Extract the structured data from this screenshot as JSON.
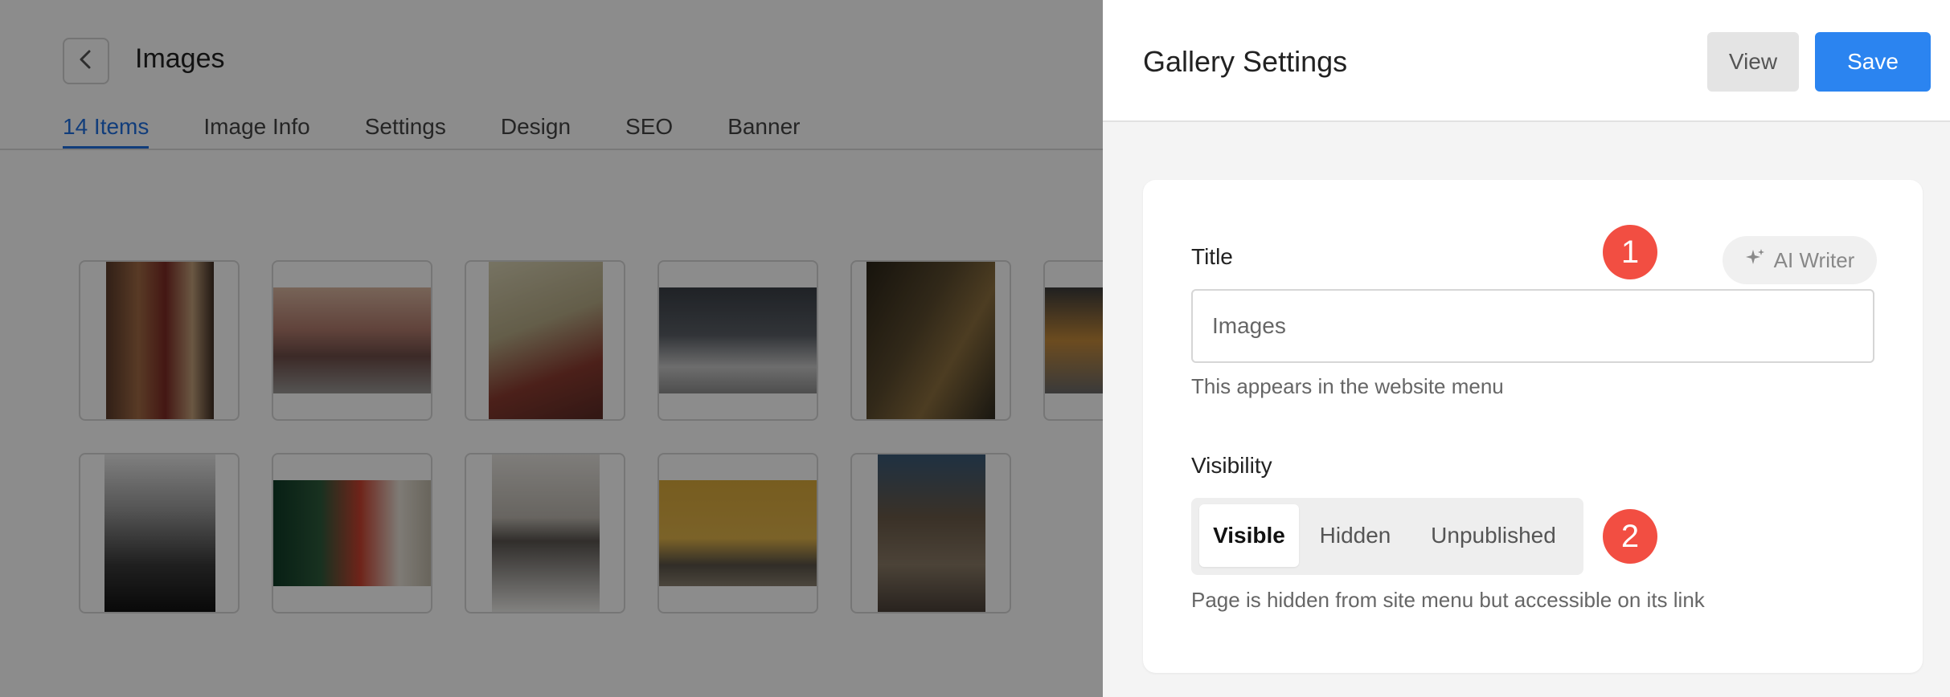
{
  "page": {
    "title": "Images",
    "tabs": [
      {
        "label": "14 Items",
        "active": true
      },
      {
        "label": "Image Info",
        "active": false
      },
      {
        "label": "Settings",
        "active": false
      },
      {
        "label": "Design",
        "active": false
      },
      {
        "label": "SEO",
        "active": false
      },
      {
        "label": "Banner",
        "active": false
      }
    ],
    "gallery_item_count": 11
  },
  "panel": {
    "title": "Gallery Settings",
    "view_label": "View",
    "save_label": "Save",
    "title_field": {
      "label": "Title",
      "value": "Images",
      "help": "This appears in the website menu",
      "ai_writer_label": "AI Writer"
    },
    "visibility": {
      "label": "Visibility",
      "options": [
        "Visible",
        "Hidden",
        "Unpublished"
      ],
      "selected": "Visible",
      "help": "Page is hidden from site menu but accessible on its link"
    },
    "markers": [
      "1",
      "2"
    ]
  },
  "colors": {
    "accent": "#2b84f0",
    "tab_active": "#1f6fe0",
    "marker": "#f24e42",
    "overlay": "rgba(0,0,0,0.45)"
  }
}
